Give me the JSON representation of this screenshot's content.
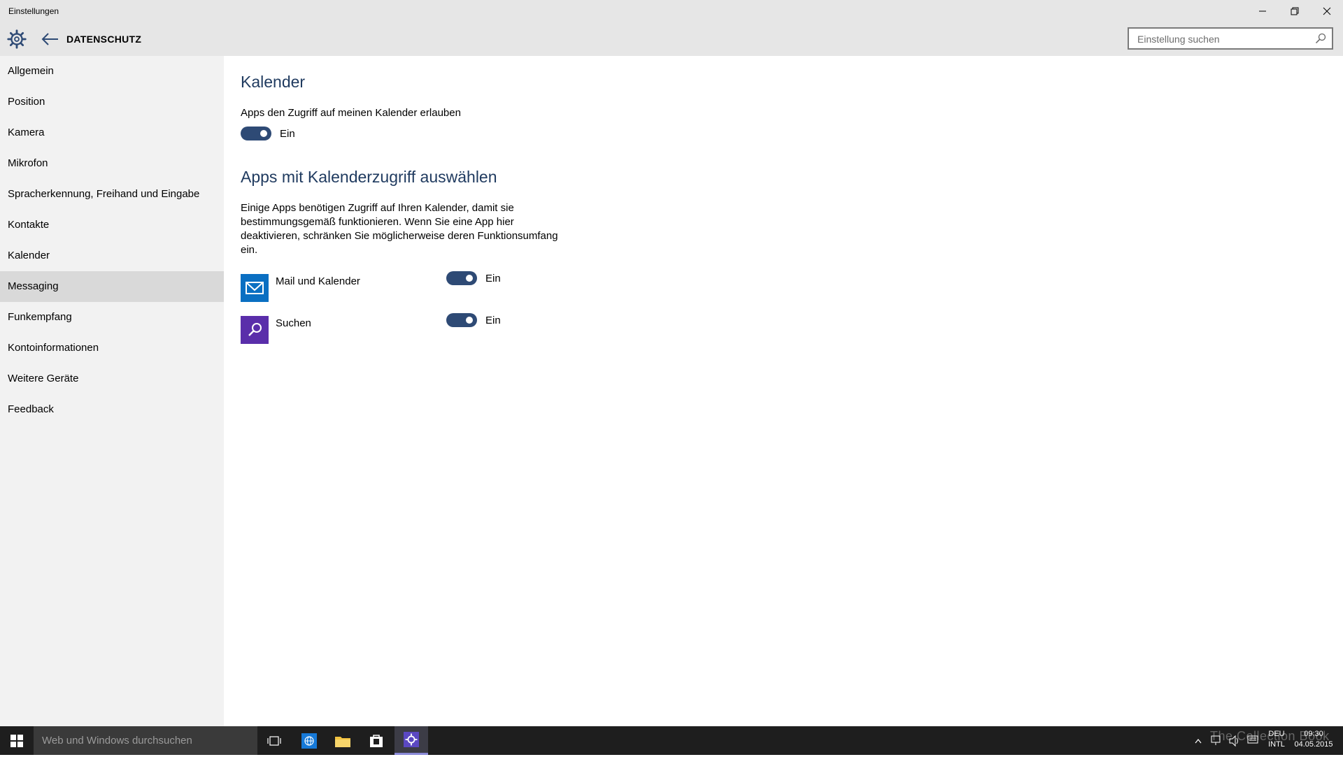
{
  "window": {
    "title": "Einstellungen"
  },
  "header": {
    "breadcrumb": "DATENSCHUTZ",
    "search_placeholder": "Einstellung suchen"
  },
  "sidebar": {
    "items": [
      {
        "label": "Allgemein"
      },
      {
        "label": "Position"
      },
      {
        "label": "Kamera"
      },
      {
        "label": "Mikrofon"
      },
      {
        "label": "Spracherkennung, Freihand und Eingabe"
      },
      {
        "label": "Kontakte"
      },
      {
        "label": "Kalender"
      },
      {
        "label": "Messaging"
      },
      {
        "label": "Funkempfang"
      },
      {
        "label": "Kontoinformationen"
      },
      {
        "label": "Weitere Geräte"
      },
      {
        "label": "Feedback"
      }
    ],
    "active_item": "Messaging"
  },
  "main": {
    "section_title": "Kalender",
    "access_label": "Apps den Zugriff auf meinen Kalender erlauben",
    "access_toggle": {
      "state_label": "Ein",
      "on": true
    },
    "apps_title": "Apps mit Kalenderzugriff auswählen",
    "apps_description": "Einige Apps benötigen Zugriff auf Ihren Kalender, damit sie bestimmungsgemäß funktionieren. Wenn Sie eine App hier deaktivieren, schränken Sie möglicherweise deren Funktionsumfang ein.",
    "apps": [
      {
        "name": "Mail und Kalender",
        "icon": "mail-icon",
        "state_label": "Ein",
        "on": true,
        "color": "#0a6fc2"
      },
      {
        "name": "Suchen",
        "icon": "search-app-icon",
        "state_label": "Ein",
        "on": true,
        "color": "#5a2eaa"
      }
    ]
  },
  "taskbar": {
    "search_placeholder": "Web und Windows durchsuchen",
    "language": "DEU",
    "layout": "INTL",
    "time": "09:30",
    "date": "04.05.2015",
    "watermark": "The Collection Book"
  },
  "colors": {
    "accent": "#2e4a75",
    "heading": "#1f3a5f",
    "chrome": "#e6e6e6",
    "sidebar": "#f2f2f2",
    "taskbar": "#1e1e1e"
  }
}
